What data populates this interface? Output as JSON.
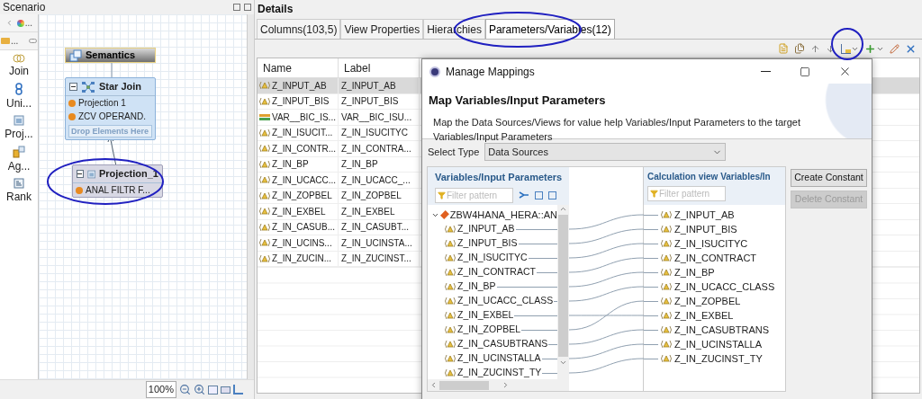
{
  "scenario": {
    "title": "Scenario",
    "palette_top": [
      {
        "label": "..."
      },
      {
        "label": "..."
      }
    ],
    "palette": [
      {
        "kind": "join",
        "label": "Join"
      },
      {
        "kind": "union",
        "label": "Uni..."
      },
      {
        "kind": "projection",
        "label": "Proj..."
      },
      {
        "kind": "aggregation",
        "label": "Ag..."
      },
      {
        "kind": "rank",
        "label": "Rank"
      }
    ],
    "nodes": [
      {
        "kind": "semantics",
        "title": "Semantics"
      },
      {
        "kind": "join",
        "title": "Star Join",
        "items": [
          "Projection  1",
          "ZCV  OPERAND."
        ],
        "drop_hint": "Drop Elements Here"
      },
      {
        "kind": "projection",
        "title": "Projection_1",
        "items": [
          "ANAL  FILTR  F..."
        ]
      }
    ],
    "zoom": "100%"
  },
  "details": {
    "title": "Details",
    "tabs": [
      {
        "label": "Columns(103,5)",
        "selected": false
      },
      {
        "label": "View Properties",
        "selected": false
      },
      {
        "label": "Hierarchies",
        "selected": false
      },
      {
        "label": "Parameters/Variables(12)",
        "selected": true
      }
    ],
    "table": {
      "columns": [
        "Name",
        "Label"
      ],
      "rows": [
        {
          "kind": "parameter",
          "name": "Z_INPUT_AB",
          "label": "Z_INPUT_AB",
          "selected": true
        },
        {
          "kind": "parameter",
          "name": "Z_INPUT_BIS",
          "label": "Z_INPUT_BIS",
          "selected": false
        },
        {
          "kind": "variable",
          "name": "VAR__BIC_IS...",
          "label": "VAR__BIC_ISU...",
          "selected": false
        },
        {
          "kind": "parameter",
          "name": "Z_IN_ISUCIT...",
          "label": "Z_IN_ISUCITYC",
          "selected": false
        },
        {
          "kind": "parameter",
          "name": "Z_IN_CONTR...",
          "label": "Z_IN_CONTRA...",
          "selected": false
        },
        {
          "kind": "parameter",
          "name": "Z_IN_BP",
          "label": "Z_IN_BP",
          "selected": false
        },
        {
          "kind": "parameter",
          "name": "Z_IN_UCACC...",
          "label": "Z_IN_UCACC_...",
          "selected": false
        },
        {
          "kind": "parameter",
          "name": "Z_IN_ZOPBEL",
          "label": "Z_IN_ZOPBEL",
          "selected": false
        },
        {
          "kind": "parameter",
          "name": "Z_IN_EXBEL",
          "label": "Z_IN_EXBEL",
          "selected": false
        },
        {
          "kind": "parameter",
          "name": "Z_IN_CASUB...",
          "label": "Z_IN_CASUBT...",
          "selected": false
        },
        {
          "kind": "parameter",
          "name": "Z_IN_UCINS...",
          "label": "Z_IN_UCINSTA...",
          "selected": false
        },
        {
          "kind": "parameter",
          "name": "Z_IN_ZUCIN...",
          "label": "Z_IN_ZUCINST...",
          "selected": false
        }
      ]
    }
  },
  "dialog": {
    "title": "Manage Mappings",
    "heading": "Map Variables/Input Parameters",
    "description": "Map the Data Sources/Views for value help  Variables/Input Parameters to the target Variables/Input Parameters",
    "select_type": {
      "label": "Select Type",
      "value": "Data Sources"
    },
    "source": {
      "title": "Variables/Input Parameters",
      "filter_placeholder": "Filter pattern",
      "root": {
        "label": "ZBW4HANA_HERA::AN",
        "expanded": true,
        "children": [
          "Z_INPUT_AB",
          "Z_INPUT_BIS",
          "Z_IN_ISUCITYC",
          "Z_IN_CONTRACT",
          "Z_IN_BP",
          "Z_IN_UCACC_CLASS",
          "Z_IN_EXBEL",
          "Z_IN_ZOPBEL",
          "Z_IN_CASUBTRANS",
          "Z_IN_UCINSTALLA",
          "Z_IN_ZUCINST_TY"
        ]
      }
    },
    "target": {
      "title": "Calculation view Variables/In",
      "filter_placeholder": "Filter pattern",
      "items": [
        "Z_INPUT_AB",
        "Z_INPUT_BIS",
        "Z_IN_ISUCITYC",
        "Z_IN_CONTRACT",
        "Z_IN_BP",
        "Z_IN_UCACC_CLASS",
        "Z_IN_ZOPBEL",
        "Z_IN_EXBEL",
        "Z_IN_CASUBTRANS",
        "Z_IN_UCINSTALLA",
        "Z_IN_ZUCINST_TY"
      ]
    },
    "buttons": [
      {
        "label": "Create Constant",
        "disabled": false
      },
      {
        "label": "Delete Constant",
        "disabled": true
      }
    ]
  }
}
